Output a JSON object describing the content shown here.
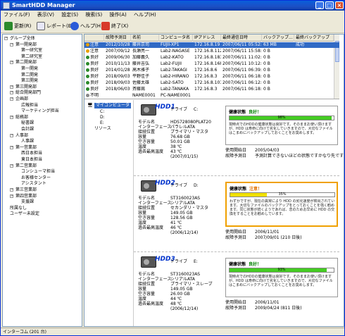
{
  "window": {
    "title": "SmartHDD Manager"
  },
  "menu": [
    "ファイル(F)",
    "表示(V)",
    "設定(S)",
    "検索(S)",
    "操作(A)",
    "ヘルプ(H)"
  ],
  "toolbar": {
    "update": "更新(R)",
    "report": "レポート(E)...",
    "help": "ヘルプ(H)",
    "exit": "終了(X)"
  },
  "tree": [
    "グループ全体",
    "第一開発部",
    "第一研究室",
    "第二研究室",
    "第二開発部",
    "第一開発",
    "第二開発",
    "第三開発",
    "第三開発部",
    "総合開発部門",
    "企画部",
    "広報担当",
    "マーケティング担当",
    "総務部",
    "秘書課",
    "会計課",
    "人事部",
    "人事課",
    "第一営業部",
    "西日本担当",
    "東日本担当",
    "第二営業部",
    "コンシューマ担当",
    "お客様センター",
    "アシスタント",
    "第三営業部",
    "第四営業部",
    "支援課",
    "所属なし",
    "ユーザー未設定"
  ],
  "grid": {
    "headers": [
      "",
      "故障予測日",
      "名前",
      "コンピュータ名",
      "IPアドレス",
      "最終通信日時",
      "バックアップ...",
      "最終バックアップ"
    ],
    "rows": [
      [
        "注意",
        "2012/10/28",
        "藤井京司",
        "FUJII-XP1",
        "172.16.8.19",
        "2007/06/11 05:52:21",
        "63 MB",
        "成功"
      ],
      [
        "注意",
        "2007/09/12",
        "長瀬亮一",
        "Lab2-NAGASE",
        "172.16.8.112",
        "2007/06/11 15:58:42",
        "0 B",
        ""
      ],
      [
        "良好",
        "2009/06/30",
        "加藤義久",
        "Lab2-KATO",
        "172.16.8.183",
        "2007/06/11 11:02:06",
        "0 B",
        ""
      ],
      [
        "良好",
        "2010/11/13",
        "藤井吉弘",
        "Lab2-FUJII",
        "172.16.8.168",
        "2007/06/11 10:12:35",
        "0 B",
        ""
      ],
      [
        "良好",
        "2014/01/28",
        "高木雅子",
        "Lab2-TAKAGI",
        "172.16.8.6",
        "2007/06/11 06:39:18",
        "0 B",
        ""
      ],
      [
        "良好",
        "2018/09/03",
        "平野佳子",
        "Lab2-HIRANO",
        "172.16.8.3",
        "2007/06/11 06:18:51:42",
        "0 B",
        ""
      ],
      [
        "良好",
        "2018/09/03",
        "佐藤太雄",
        "Lab2-SATO",
        "172.16.8.101",
        "2007/06/11 06:12:05:03",
        "0 B",
        ""
      ],
      [
        "良好",
        "2018/06/03",
        "斉藤嵩",
        "Lab2-TANAKA",
        "172.16.8.3",
        "2007/06/11 06:18:51:42",
        "0 B",
        ""
      ],
      [
        "不明",
        "",
        "NAME0001",
        "PC-NAME0001",
        "",
        "",
        "",
        ""
      ]
    ],
    "status_colors": {
      "注意": "#e8a000",
      "良好": "#2a8a2a",
      "不明": "#888888"
    }
  },
  "subtree": {
    "root": "マイコンピュータ",
    "items": [
      "C:",
      "D:",
      "E:",
      "リソース"
    ]
  },
  "drives": [
    {
      "label": "HDD1",
      "drive_label": "ドライブ",
      "drive": "C:",
      "fields": [
        [
          "モデル名",
          "HDS728080PLAT20"
        ],
        [
          "インターフェース",
          "パラレルATA"
        ],
        [
          "接続位置",
          "プライマリ・マスタ"
        ],
        [
          "容量",
          "76.68 GB"
        ],
        [
          "空き容量",
          "50.01 GB"
        ],
        [
          "温度",
          "38 ℃"
        ],
        [
          "過去最高温度",
          "43 ℃"
        ],
        [
          "",
          "(2007/01/15)"
        ]
      ],
      "health_title": "健康状態",
      "health_status": "良好！",
      "status_color": "#008000",
      "percent": 0.98,
      "percent_text": "98%",
      "bar_color": "#44cc22",
      "desc": "現時点でのHDDの健康状態は良好です。そのままお使い頂けますが、HDD は寿命に向けて劣化していきますので、大切なファイルはこまめにバックアップしておくことをお奨めします。",
      "start_label": "使用開始日",
      "start": "2005/04/03",
      "pred_label": "故障予測日",
      "pred": "予測計算できないほどの状態ですかなり先です"
    },
    {
      "label": "HDD2",
      "drive_label": "ドライブ",
      "drive": "D:",
      "fields": [
        [
          "モデル名",
          "ST3160023AS"
        ],
        [
          "インターフェース",
          "シリアルATA"
        ],
        [
          "接続位置",
          "セカンダリ・マスタ"
        ],
        [
          "容量",
          "149.05 GB"
        ],
        [
          "空き容量",
          "128.56 GB"
        ],
        [
          "温度",
          "41 ℃"
        ],
        [
          "過去最高温度",
          "46 ℃"
        ],
        [
          "",
          "(2006/12/14)"
        ]
      ],
      "health_title": "健康状態",
      "health_status": "注意！",
      "status_color": "#e07000",
      "percent": 0.35,
      "percent_text": "35%",
      "bar_color": "#f0e000",
      "desc": "わずかですが、現在の異常により HDD の劣化速度が検出されています。大切なファイルのバックアップをとっておくことを強く勧めます。同じ状態が続くようであれば、念のためお早めに HDD の交換をすることをお勧めしています。",
      "start_label": "使用開始日",
      "start": "2006/11/01",
      "pred_label": "故障予測日",
      "pred": "2007/09/01 (210 日後)"
    },
    {
      "label": "HDD3",
      "drive_label": "ドライブ",
      "drive": "E:",
      "fields": [
        [
          "モデル名",
          "ST3160023AS"
        ],
        [
          "インターフェース",
          "シリアルATA"
        ],
        [
          "接続位置",
          "プライマリ・スレーブ"
        ],
        [
          "容量",
          "149.05 GB"
        ],
        [
          "空き容量",
          "26.00 GB"
        ],
        [
          "温度",
          "44 ℃"
        ],
        [
          "過去最高温度",
          "48 ℃"
        ],
        [
          "",
          "(2006/12/14)"
        ]
      ],
      "health_title": "健康状態",
      "health_status": "良好！",
      "status_color": "#008000",
      "percent": 0.93,
      "percent_text": "93%",
      "bar_color": "#44cc22",
      "desc": "現時点でのHDDの健康状態は良好です。そのままお使い頂けますが、HDD は寿命に向けて劣化していきますので、大切なファイルはこまめにバックアップしておくことをお奨めします。",
      "start_label": "使用開始日",
      "start": "2006/11/01",
      "pred_label": "故障予測日",
      "pred": "2009/04/24 (811 日後)"
    }
  ],
  "status": "インターコム (201 台)"
}
